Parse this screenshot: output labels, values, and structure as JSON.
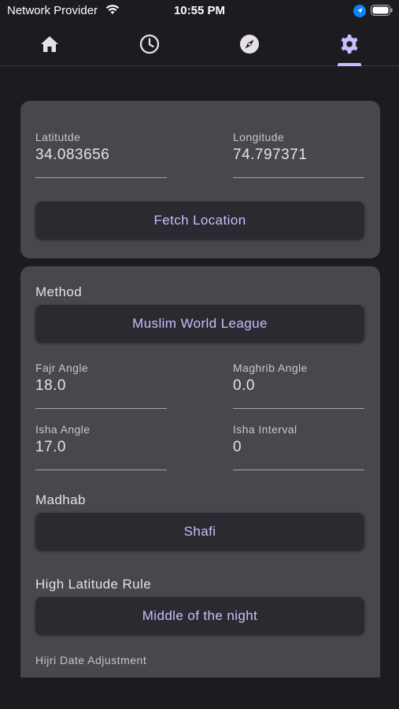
{
  "status_bar": {
    "carrier": "Network Provider",
    "time": "10:55 PM",
    "wifi_icon": "wifi-icon",
    "location_icon": "location-arrow-icon",
    "battery_icon": "battery-icon"
  },
  "tabs": [
    {
      "icon": "home-icon",
      "selected": false
    },
    {
      "icon": "clock-icon",
      "selected": false
    },
    {
      "icon": "compass-icon",
      "selected": false
    },
    {
      "icon": "gear-icon",
      "selected": true
    }
  ],
  "location": {
    "latitude_label": "Latitutde",
    "latitude_value": "34.083656",
    "longitude_label": "Longitude",
    "longitude_value": "74.797371",
    "fetch_button": "Fetch Location"
  },
  "settings": {
    "method_label": "Method",
    "method_value": "Muslim World League",
    "fajr_angle_label": "Fajr Angle",
    "fajr_angle_value": "18.0",
    "maghrib_angle_label": "Maghrib Angle",
    "maghrib_angle_value": "0.0",
    "isha_angle_label": "Isha Angle",
    "isha_angle_value": "17.0",
    "isha_interval_label": "Isha Interval",
    "isha_interval_value": "0",
    "madhab_label": "Madhab",
    "madhab_value": "Shafi",
    "high_latitude_label": "High Latitude Rule",
    "high_latitude_value": "Middle of the night",
    "hijri_label": "Hijri Date Adjustment"
  },
  "colors": {
    "background": "#1c1b1f",
    "card": "#48474d",
    "button": "#2b2a30",
    "accent": "#c8bfff",
    "status_location_blue": "#0a84ff"
  }
}
